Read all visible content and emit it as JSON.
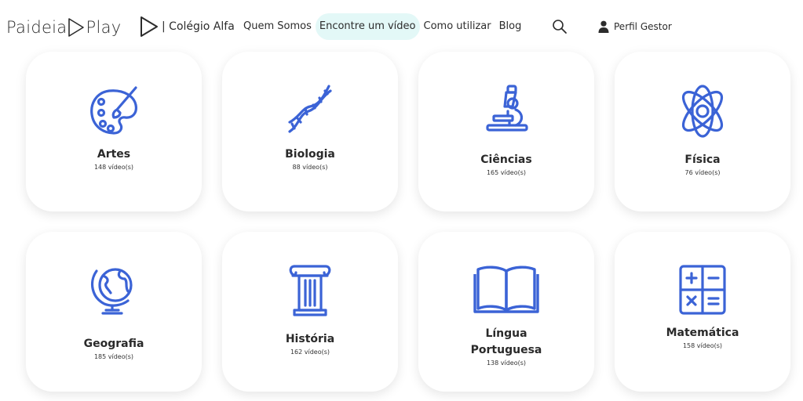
{
  "brand": {
    "logo_left": "Paideia",
    "logo_right": "Play"
  },
  "school": {
    "name": "| Colégio Alfa"
  },
  "nav": {
    "items": [
      {
        "label": "Quem Somos"
      },
      {
        "label": "Encontre um vídeo"
      },
      {
        "label": "Como utilizar"
      },
      {
        "label": "Blog"
      }
    ]
  },
  "search": {
    "icon": "search-icon"
  },
  "profile": {
    "icon": "user-icon",
    "label": "Perfil Gestor"
  },
  "colors": {
    "accent": "#3b63d6",
    "active_bg": "#e3f8f7"
  },
  "subjects": [
    {
      "title": "Artes",
      "count": "148 vídeo(s)",
      "icon": "palette-icon"
    },
    {
      "title": "Biologia",
      "count": "88 vídeo(s)",
      "icon": "dna-icon"
    },
    {
      "title": "Ciências",
      "count": "165 vídeo(s)",
      "icon": "microscope-icon"
    },
    {
      "title": "Física",
      "count": "76 vídeo(s)",
      "icon": "atom-icon"
    },
    {
      "title": "Geografia",
      "count": "185 vídeo(s)",
      "icon": "globe-icon"
    },
    {
      "title": "História",
      "count": "162 vídeo(s)",
      "icon": "column-icon"
    },
    {
      "title_line1": "Língua",
      "title_line2": "Portuguesa",
      "count": "138 vídeo(s)",
      "icon": "book-icon"
    },
    {
      "title": "Matemática",
      "count": "158 vídeo(s)",
      "icon": "calculator-icon"
    }
  ]
}
